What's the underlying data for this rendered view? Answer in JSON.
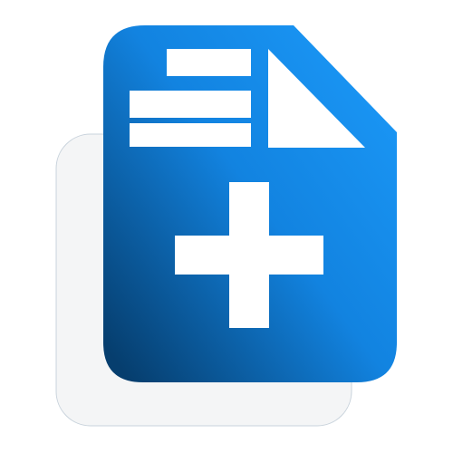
{
  "icon": {
    "name": "new-document-icon",
    "description_label": "",
    "colors": {
      "page_gradient_light": "#1a96f5",
      "page_gradient_mid": "#0f7fd8",
      "page_gradient_dark": "#063e6e",
      "backing_card": "#f4f5f6",
      "backing_card_border": "#c9d3dc",
      "glyph": "#ffffff"
    }
  }
}
